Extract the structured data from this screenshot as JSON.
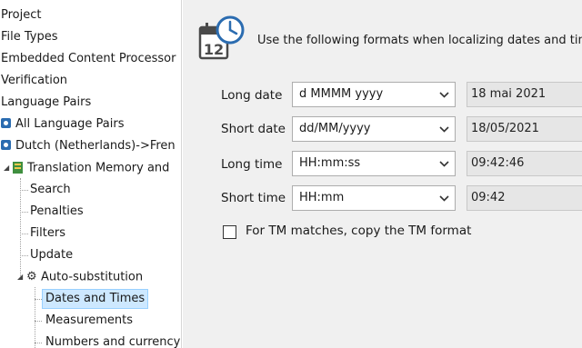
{
  "tree": {
    "project": "Project",
    "file_types": "File Types",
    "embedded_content_processor": "Embedded Content Processor",
    "verification": "Verification",
    "language_pairs": "Language Pairs",
    "all_language_pairs": "All Language Pairs",
    "dutch_pair": "Dutch (Netherlands)->Fren",
    "translation_memory": "Translation Memory and",
    "search": "Search",
    "penalties": "Penalties",
    "filters": "Filters",
    "update": "Update",
    "auto_substitution": "Auto-substitution",
    "dates_and_times": "Dates and Times",
    "measurements": "Measurements",
    "numbers_and_currency": "Numbers and currency"
  },
  "header": {
    "icon": "calendar-clock-icon",
    "calendar_number": "12",
    "text": "Use the following formats when localizing dates and times"
  },
  "formats": {
    "long_date": {
      "label": "Long date",
      "value": "d MMMM yyyy",
      "preview": "18 mai 2021"
    },
    "short_date": {
      "label": "Short date",
      "value": "dd/MM/yyyy",
      "preview": "18/05/2021"
    },
    "long_time": {
      "label": "Long time",
      "value": "HH:mm:ss",
      "preview": "09:42:46"
    },
    "short_time": {
      "label": "Short time",
      "value": "HH:mm",
      "preview": "09:42"
    }
  },
  "tm_format_checkbox": {
    "label": "For TM matches, copy the TM format",
    "checked": false
  },
  "colors": {
    "selection_bg": "#cde8ff",
    "selection_border": "#99d1ff",
    "panel_bg": "#f0f0f0",
    "preview_bg": "#e6e6e6",
    "icon_blue": "#2b6cb0"
  }
}
